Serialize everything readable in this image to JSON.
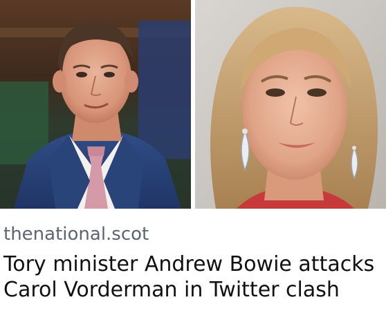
{
  "link_card": {
    "images": [
      {
        "subject": "man-in-suit-photo",
        "alt": ""
      },
      {
        "subject": "woman-with-earrings-photo",
        "alt": ""
      }
    ],
    "domain": "thenational.scot",
    "headline": "Tory minister Andrew Bowie attacks Carol Vorderman in Twitter clash"
  },
  "colors": {
    "domain_text": "#5b6670",
    "headline_text": "#111111",
    "background": "#ffffff"
  }
}
